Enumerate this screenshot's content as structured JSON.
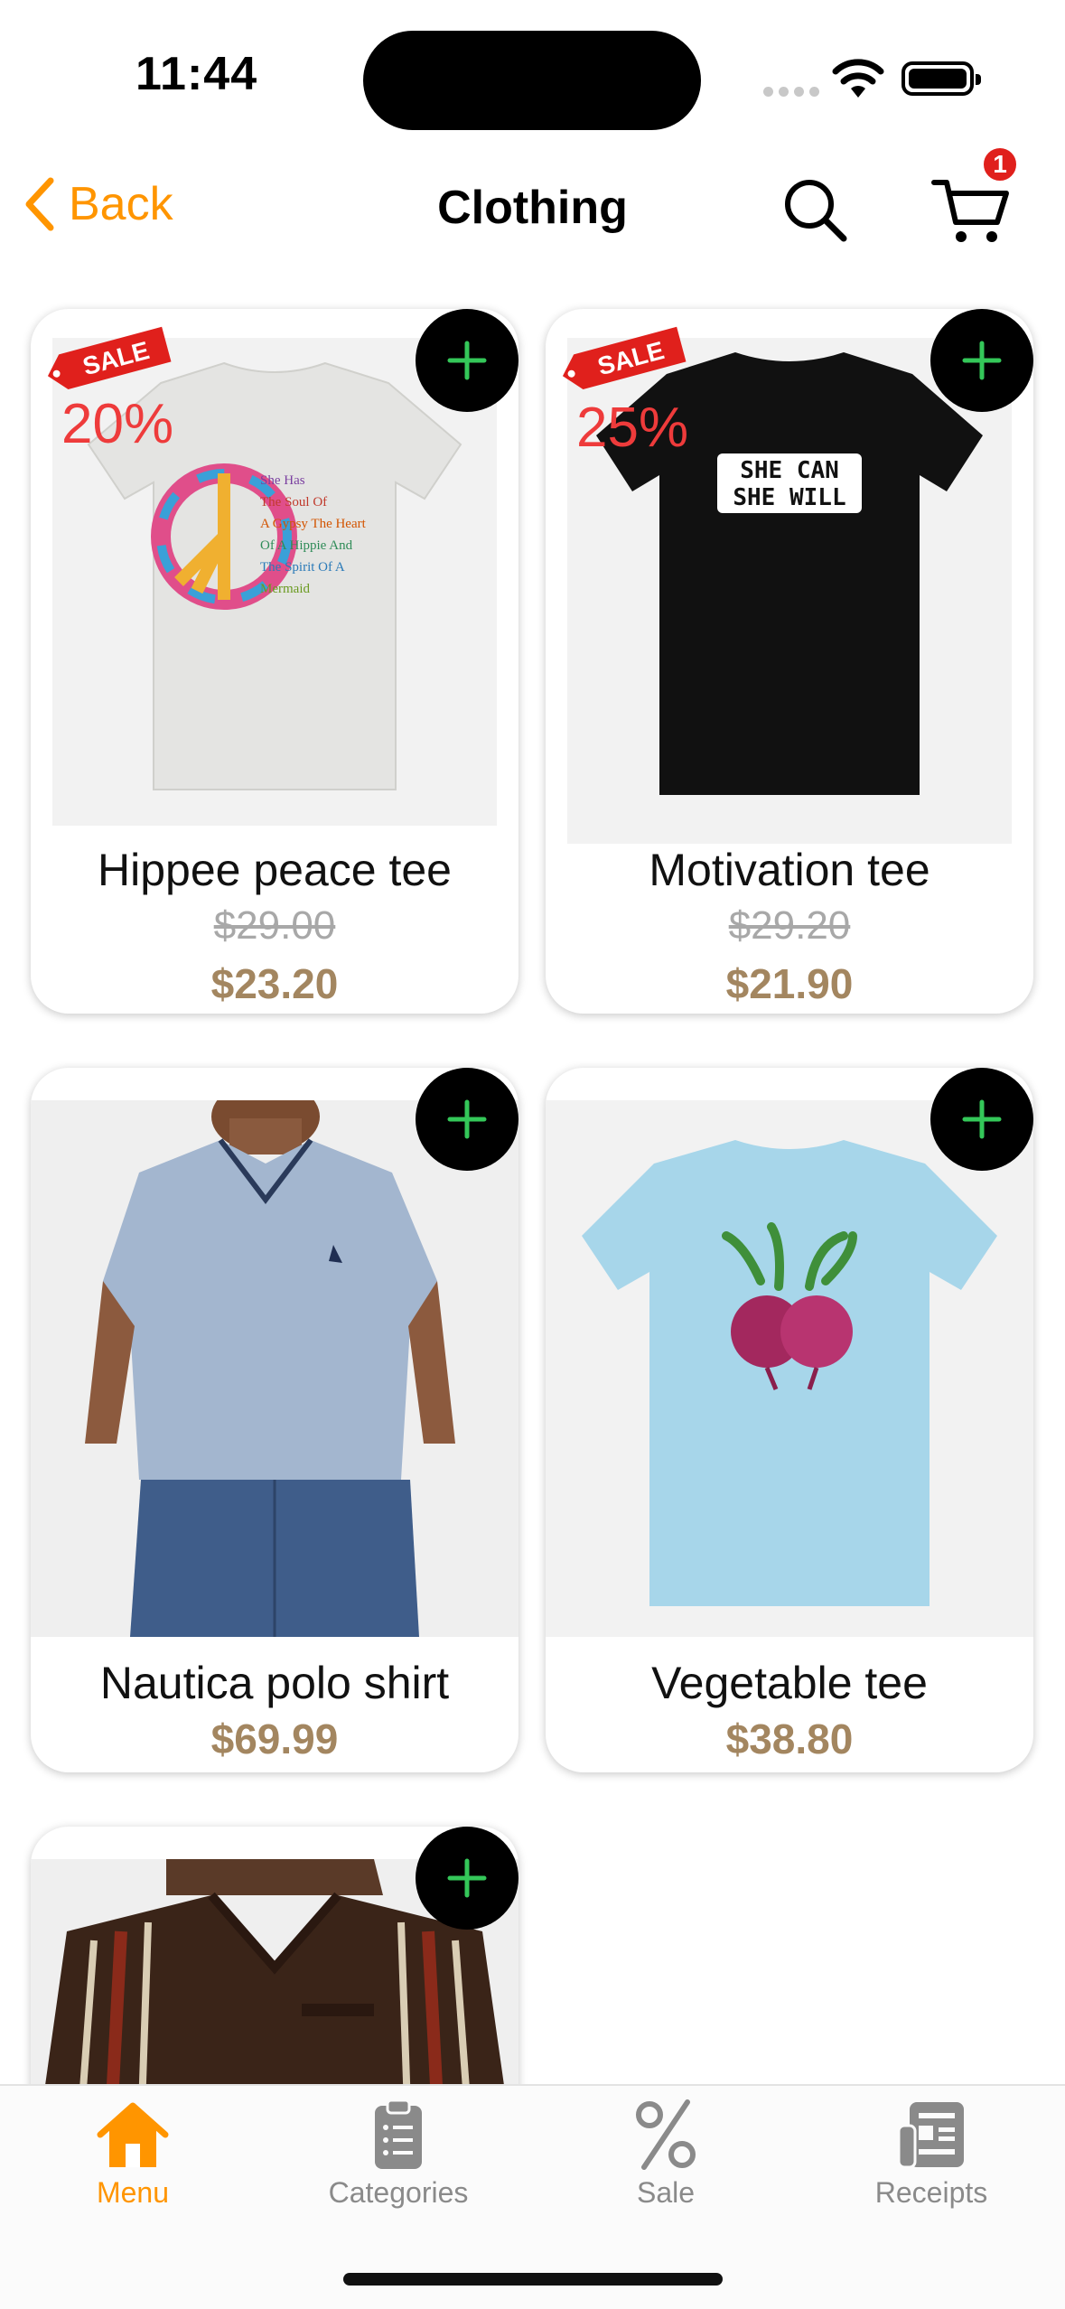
{
  "status_bar": {
    "time": "11:44"
  },
  "nav": {
    "back_label": "Back",
    "title": "Clothing",
    "cart_count": "1"
  },
  "products": [
    {
      "name": "Hippee peace tee",
      "old_price": "$29.00",
      "price": "$23.20",
      "sale": "SALE",
      "discount": "20%",
      "shirt_text": [
        "She Has",
        "The Soul Of",
        "A Gypsy The Heart",
        "Of A Hippie And",
        "The Spirit Of A",
        "Mermaid"
      ]
    },
    {
      "name": "Motivation tee",
      "old_price": "$29.20",
      "price": "$21.90",
      "sale": "SALE",
      "discount": "25%",
      "shirt_text": [
        "SHE CAN",
        "SHE WILL"
      ]
    },
    {
      "name": "Nautica polo shirt",
      "price": "$69.99"
    },
    {
      "name": "Vegetable tee",
      "price": "$38.80"
    },
    {
      "name": ""
    }
  ],
  "tabs": [
    {
      "label": "Menu",
      "icon": "home-icon",
      "active": true
    },
    {
      "label": "Categories",
      "icon": "clipboard-icon",
      "active": false
    },
    {
      "label": "Sale",
      "icon": "percent-icon",
      "active": false
    },
    {
      "label": "Receipts",
      "icon": "receipt-icon",
      "active": false
    }
  ],
  "colors": {
    "accent": "#ff9500",
    "price": "#a38660",
    "sale_red": "#e0201c",
    "add_plus": "#34c759"
  }
}
